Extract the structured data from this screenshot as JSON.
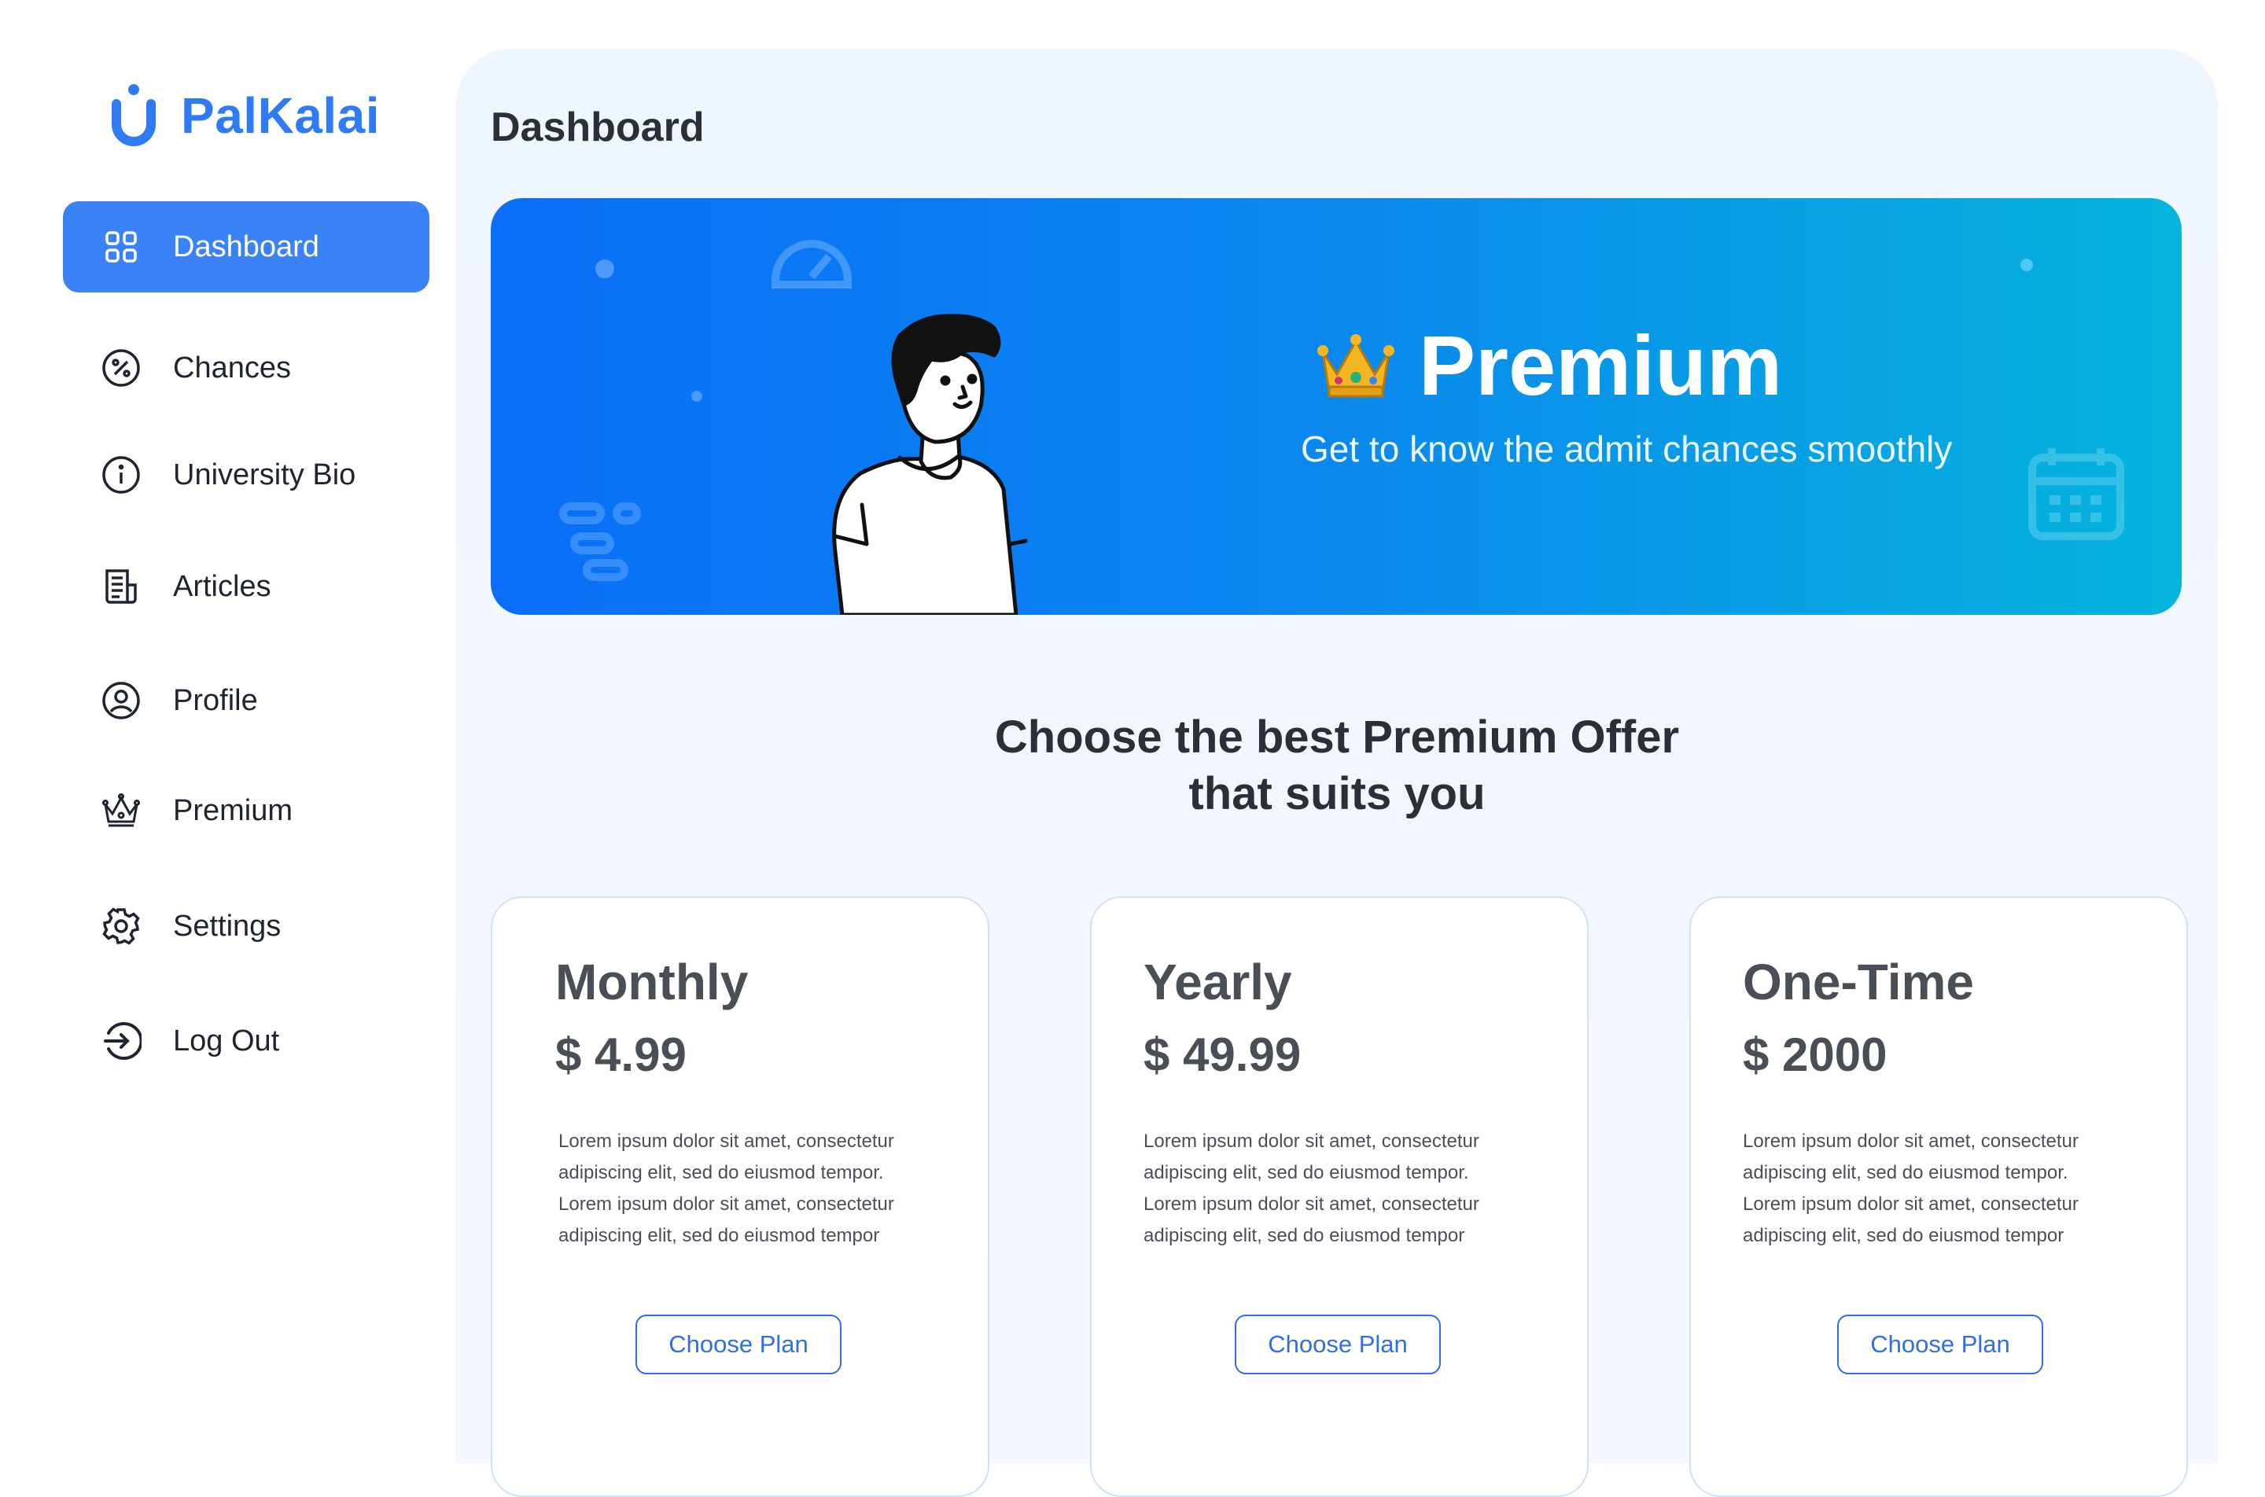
{
  "brand": {
    "name": "PalKalai",
    "color": "#2f7bf5"
  },
  "sidebar": {
    "items": [
      {
        "label": "Dashboard",
        "icon": "grid-icon",
        "active": true
      },
      {
        "label": "Chances",
        "icon": "percent-icon"
      },
      {
        "label": "University Bio",
        "icon": "info-icon"
      },
      {
        "label": "Articles",
        "icon": "newspaper-icon"
      },
      {
        "label": "Profile",
        "icon": "user-circle-icon"
      },
      {
        "label": "Premium",
        "icon": "crown-icon"
      },
      {
        "label": "Settings",
        "icon": "gear-icon"
      },
      {
        "label": "Log Out",
        "icon": "logout-icon"
      }
    ]
  },
  "main": {
    "title": "Dashboard",
    "banner": {
      "title": "Premium",
      "subtitle": "Get to know the admit chances smoothly"
    },
    "offer_heading_line1": "Choose the best Premium Offer",
    "offer_heading_line2": "that suits you",
    "plans": [
      {
        "name": "Monthly",
        "price": "$ 4.99",
        "desc": "Lorem ipsum dolor sit amet, consectetur adipiscing elit, sed do eiusmod tempor. Lorem ipsum dolor sit amet, consectetur adipiscing elit, sed do eiusmod tempor",
        "button": "Choose Plan"
      },
      {
        "name": "Yearly",
        "price": "$ 49.99",
        "desc": "Lorem ipsum dolor sit amet, consectetur adipiscing elit, sed do eiusmod tempor. Lorem ipsum dolor sit amet, consectetur adipiscing elit, sed do eiusmod tempor",
        "button": "Choose Plan"
      },
      {
        "name": "One-Time",
        "price": "$ 2000",
        "desc": "Lorem ipsum dolor sit amet, consectetur adipiscing elit, sed do eiusmod tempor. Lorem ipsum dolor sit amet, consectetur adipiscing elit, sed do eiusmod tempor",
        "button": "Choose Plan"
      }
    ]
  },
  "colors": {
    "accent": "#3b82f6",
    "banner_start": "#0a6ef8",
    "banner_end": "#05b4dc",
    "button_border": "#2f6ee5"
  }
}
